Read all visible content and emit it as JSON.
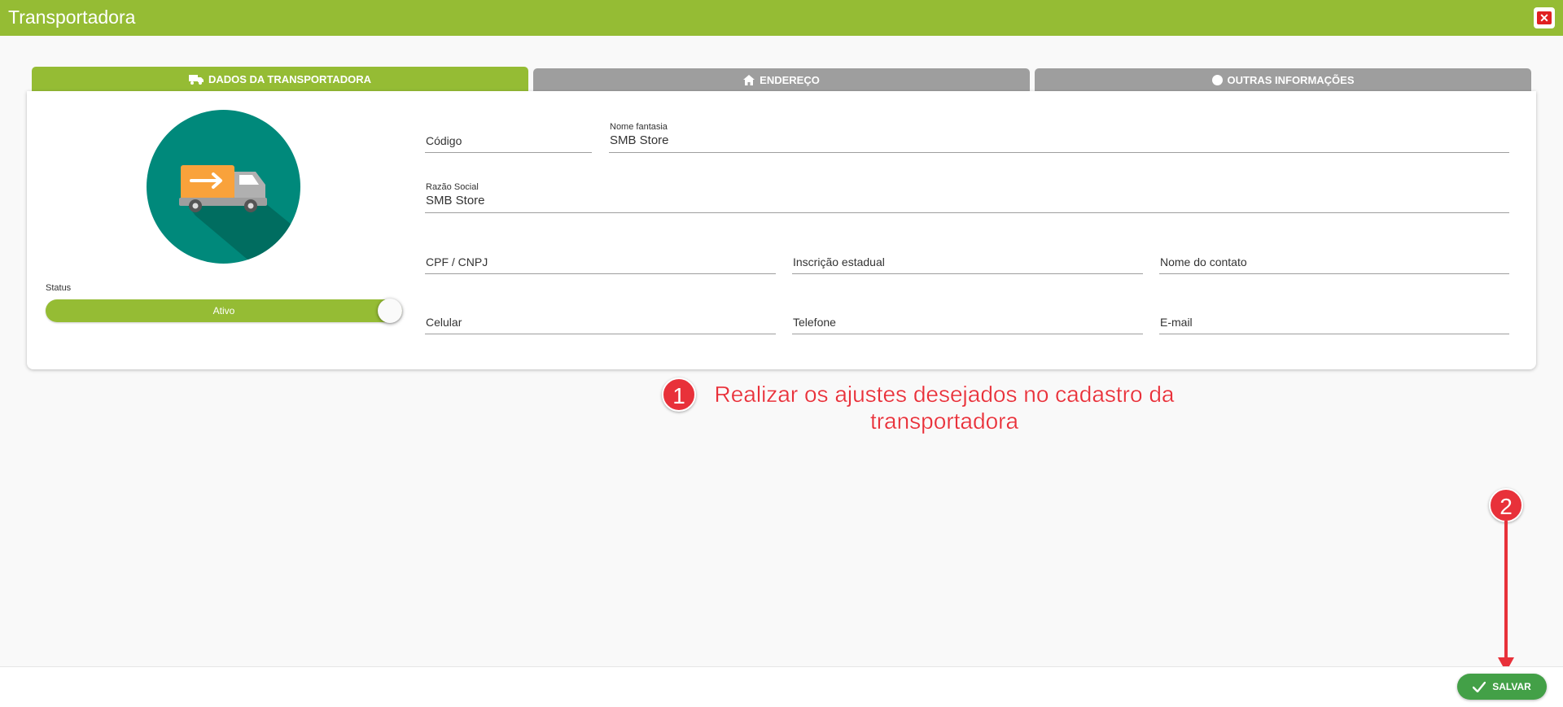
{
  "window": {
    "title": "Transportadora",
    "close_icon": "close-icon",
    "close_color": "#e02020"
  },
  "tabs": [
    {
      "label": "DADOS DA TRANSPORTADORA",
      "icon": "truck-icon",
      "active": true
    },
    {
      "label": "ENDEREÇO",
      "icon": "home-icon",
      "active": false
    },
    {
      "label": "OUTRAS INFORMAÇÕES",
      "icon": "info-icon",
      "active": false
    }
  ],
  "avatar": {
    "icon": "delivery-truck-icon",
    "color": "#00897b"
  },
  "status": {
    "label": "Status",
    "toggle_label": "Ativo",
    "on": true
  },
  "fields": {
    "codigo": {
      "label": "Código",
      "value": ""
    },
    "nome_fantasia": {
      "label": "Nome fantasia",
      "value": "SMB Store"
    },
    "razao_social": {
      "label": "Razão Social",
      "value": "SMB Store"
    },
    "cpf_cnpj": {
      "label": "CPF / CNPJ",
      "value": ""
    },
    "inscricao_estadual": {
      "label": "Inscrição estadual",
      "value": ""
    },
    "nome_contato": {
      "label": "Nome do contato",
      "value": ""
    },
    "celular": {
      "label": "Celular",
      "value": ""
    },
    "telefone": {
      "label": "Telefone",
      "value": ""
    },
    "email": {
      "label": "E-mail",
      "value": ""
    }
  },
  "annotations": {
    "step1_number": "1",
    "step1_text_line1": "Realizar os ajustes desejados no cadastro da",
    "step1_text_line2": "transportadora",
    "step2_number": "2"
  },
  "footer": {
    "save_label": "SALVAR",
    "save_icon": "check-icon"
  },
  "colors": {
    "primary": "#95bc34",
    "inactive_tab": "#9e9e9e",
    "save": "#43a047",
    "annotation": "#e8313a"
  }
}
